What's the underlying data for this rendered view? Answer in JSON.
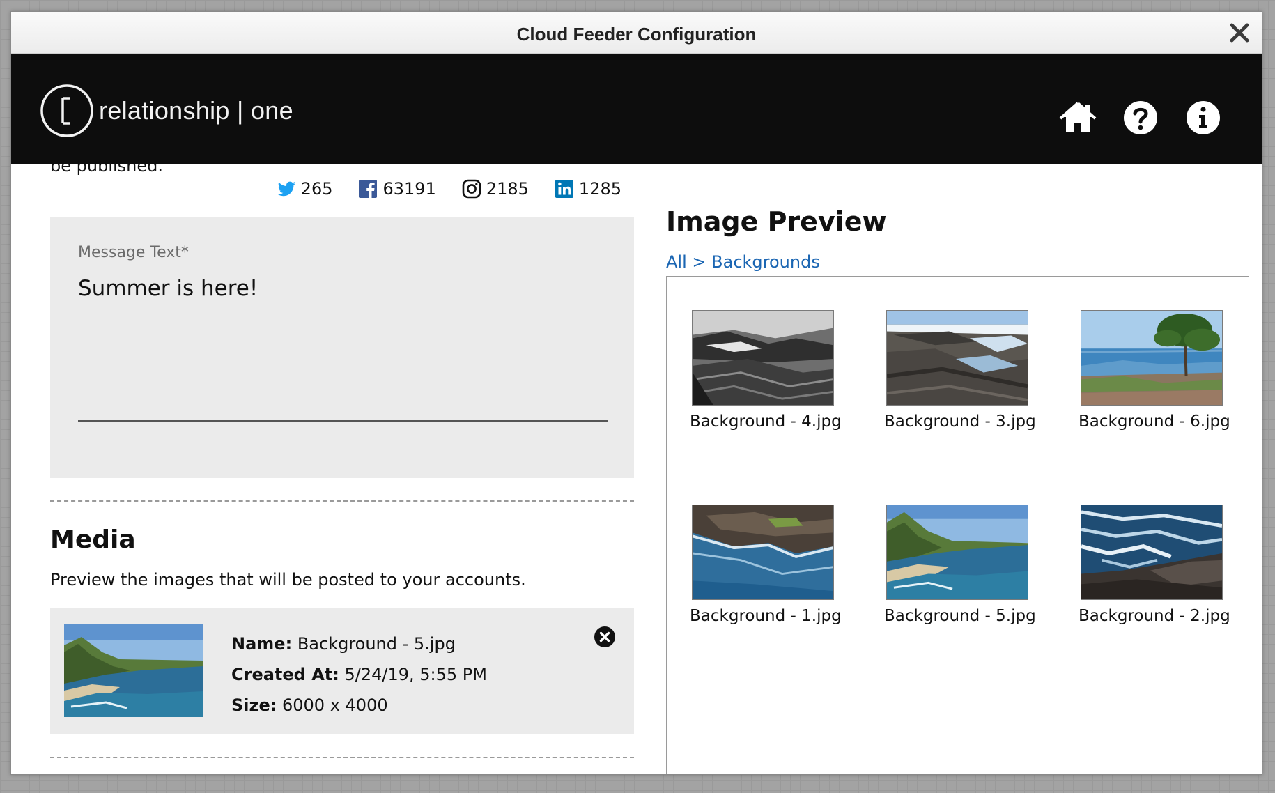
{
  "window": {
    "title": "Cloud Feeder Configuration",
    "close_icon": "close-icon"
  },
  "header": {
    "logo_text": "relationship | one",
    "icons": [
      "home-icon",
      "help-icon",
      "info-icon"
    ]
  },
  "compose": {
    "cut_text": "be published.",
    "social_counts": [
      {
        "network": "twitter",
        "count": "265",
        "color": "#1da1f2"
      },
      {
        "network": "facebook",
        "count": "63191",
        "color": "#3b5998"
      },
      {
        "network": "instagram",
        "count": "2185",
        "color": "#111111"
      },
      {
        "network": "linkedin",
        "count": "1285",
        "color": "#0077b5"
      }
    ],
    "message_label": "Message Text*",
    "message_value": "Summer is here!"
  },
  "media": {
    "title": "Media",
    "description": "Preview the images that will be posted to your accounts.",
    "selected": {
      "name_label": "Name:",
      "name_value": "Background - 5.jpg",
      "created_label": "Created At:",
      "created_value": "5/24/19, 5:55 PM",
      "size_label": "Size:",
      "size_value": "6000 x 4000"
    }
  },
  "preview": {
    "title": "Image Preview",
    "breadcrumb_all": "All",
    "breadcrumb_sep": ">",
    "breadcrumb_current": "Backgrounds",
    "images": [
      {
        "name": "Background - 4.jpg",
        "style": "bw-rocks"
      },
      {
        "name": "Background - 3.jpg",
        "style": "rocks-pools"
      },
      {
        "name": "Background - 6.jpg",
        "style": "tree-shore"
      },
      {
        "name": "Background - 1.jpg",
        "style": "cliff-sea"
      },
      {
        "name": "Background - 5.jpg",
        "style": "bay-coast"
      },
      {
        "name": "Background - 2.jpg",
        "style": "surf-rocks"
      }
    ]
  },
  "colors": {
    "header_bg": "#0d0d0d",
    "link": "#1b66b3",
    "panel_bg": "#ebebeb"
  }
}
